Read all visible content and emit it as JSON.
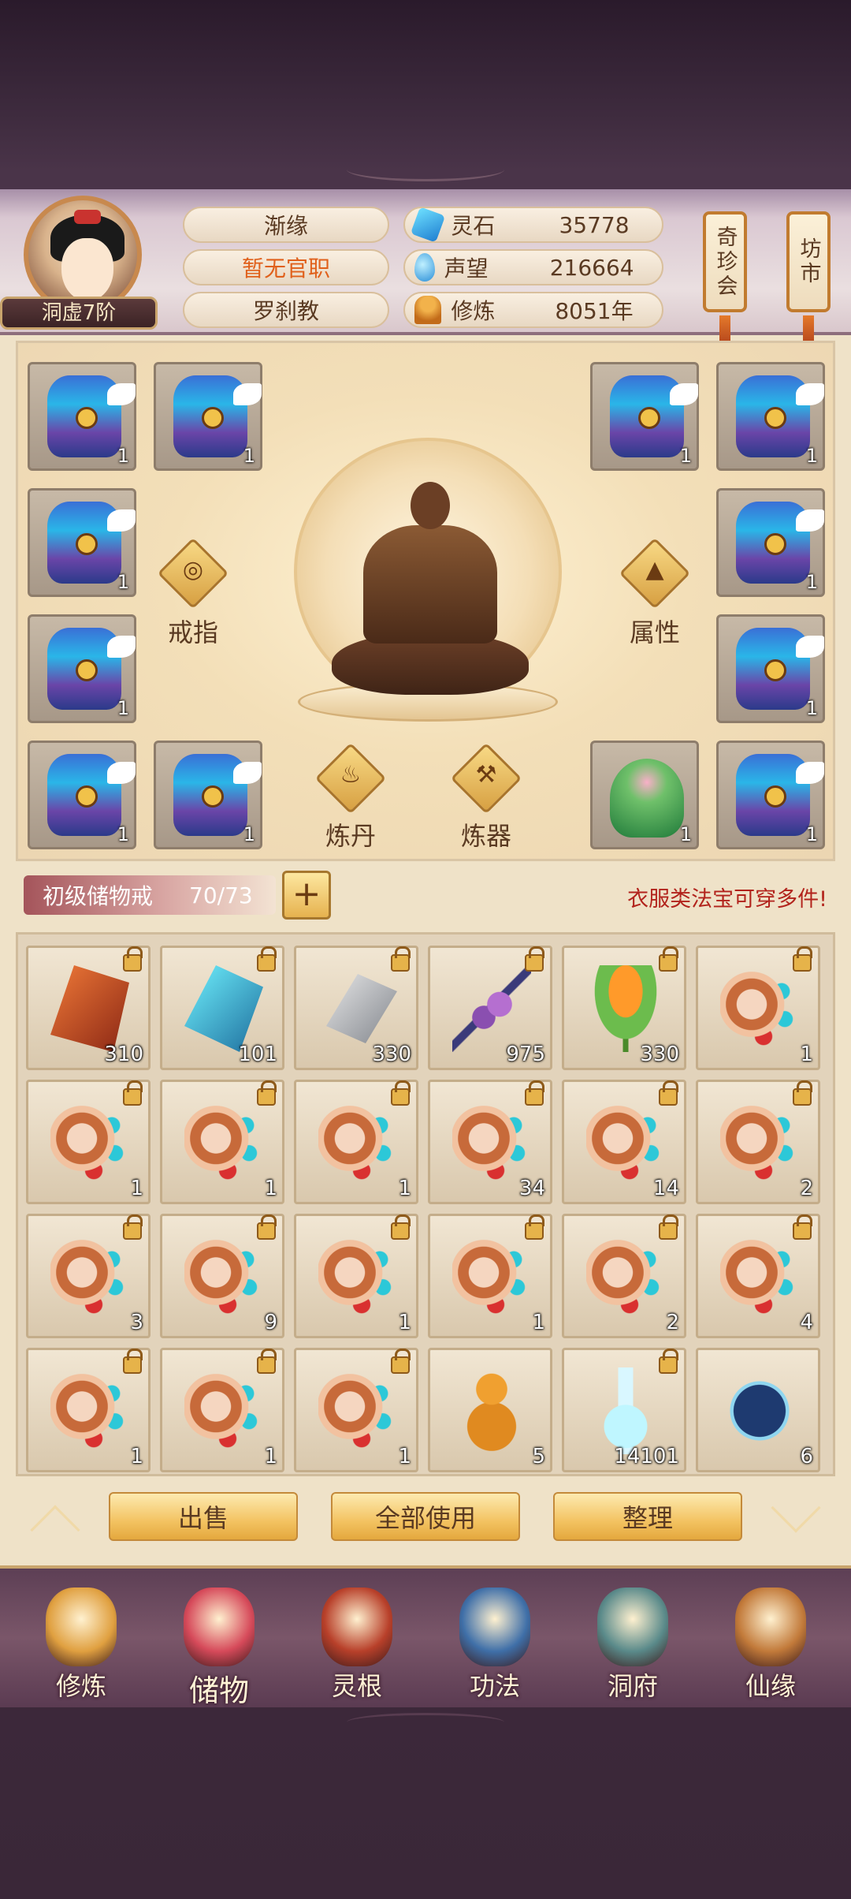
{
  "header": {
    "avatar_rank": "洞虚7阶",
    "name": "渐缘",
    "title": "暂无官职",
    "sect": "罗刹教",
    "resources": [
      {
        "label": "灵石",
        "value": "35778",
        "icon": "spirit-stone-icon"
      },
      {
        "label": "声望",
        "value": "216664",
        "icon": "prestige-icon"
      },
      {
        "label": "修炼",
        "value": "8051年",
        "icon": "cultivation-icon"
      }
    ],
    "signs": [
      "奇珍会",
      "坊市"
    ]
  },
  "equipment": {
    "slots": [
      {
        "count": "1"
      },
      {
        "count": "1"
      },
      {
        "count": "1"
      },
      {
        "count": "1"
      },
      {
        "count": "1"
      },
      {
        "count": "1"
      },
      {
        "count": "1"
      },
      {
        "count": "1"
      },
      {
        "count": "1"
      },
      {
        "count": "1"
      },
      {
        "count": "1"
      },
      {
        "count": "1"
      }
    ],
    "buttons": {
      "ring": "戒指",
      "attributes": "属性",
      "alchemy": "炼丹",
      "forge": "炼器"
    }
  },
  "storage": {
    "name": "初级储物戒",
    "capacity": "70/73",
    "plus": "+",
    "hint": "衣服类法宝可穿多件!"
  },
  "inventory": [
    {
      "icon": "red-ore",
      "count": "310",
      "locked": true
    },
    {
      "icon": "teal-crystal",
      "count": "101",
      "locked": true
    },
    {
      "icon": "silver-ore",
      "count": "330",
      "locked": true
    },
    {
      "icon": "purple-berry",
      "count": "975",
      "locked": true
    },
    {
      "icon": "lotus-pod",
      "count": "330",
      "locked": true
    },
    {
      "icon": "conch",
      "count": "1",
      "locked": true
    },
    {
      "icon": "conch",
      "count": "1",
      "locked": true
    },
    {
      "icon": "conch",
      "count": "1",
      "locked": true
    },
    {
      "icon": "conch",
      "count": "1",
      "locked": true
    },
    {
      "icon": "conch",
      "count": "34",
      "locked": true
    },
    {
      "icon": "conch",
      "count": "14",
      "locked": true
    },
    {
      "icon": "conch",
      "count": "2",
      "locked": true
    },
    {
      "icon": "conch",
      "count": "3",
      "locked": true
    },
    {
      "icon": "conch",
      "count": "9",
      "locked": true
    },
    {
      "icon": "conch",
      "count": "1",
      "locked": true
    },
    {
      "icon": "conch",
      "count": "1",
      "locked": true
    },
    {
      "icon": "conch",
      "count": "2",
      "locked": true
    },
    {
      "icon": "conch",
      "count": "4",
      "locked": true
    },
    {
      "icon": "conch",
      "count": "1",
      "locked": true
    },
    {
      "icon": "conch",
      "count": "1",
      "locked": true
    },
    {
      "icon": "conch",
      "count": "1",
      "locked": true
    },
    {
      "icon": "gourd",
      "count": "5",
      "locked": false
    },
    {
      "icon": "bottle",
      "count": "14101",
      "locked": true
    },
    {
      "icon": "star-chart",
      "count": "6",
      "locked": false
    }
  ],
  "actions": {
    "sell": "出售",
    "use_all": "全部使用",
    "arrange": "整理"
  },
  "nav": [
    {
      "label": "修炼",
      "icon": "monk-icon",
      "color": "#e0a040"
    },
    {
      "label": "储物",
      "icon": "bag-icon",
      "color": "#d64a5a"
    },
    {
      "label": "灵根",
      "icon": "root-orb-icon",
      "color": "#b8402a"
    },
    {
      "label": "功法",
      "icon": "book-icon",
      "color": "#3f6fa8"
    },
    {
      "label": "洞府",
      "icon": "cave-house-icon",
      "color": "#5a8a8a"
    },
    {
      "label": "仙缘",
      "icon": "gourd-icon",
      "color": "#c27a3a"
    }
  ]
}
